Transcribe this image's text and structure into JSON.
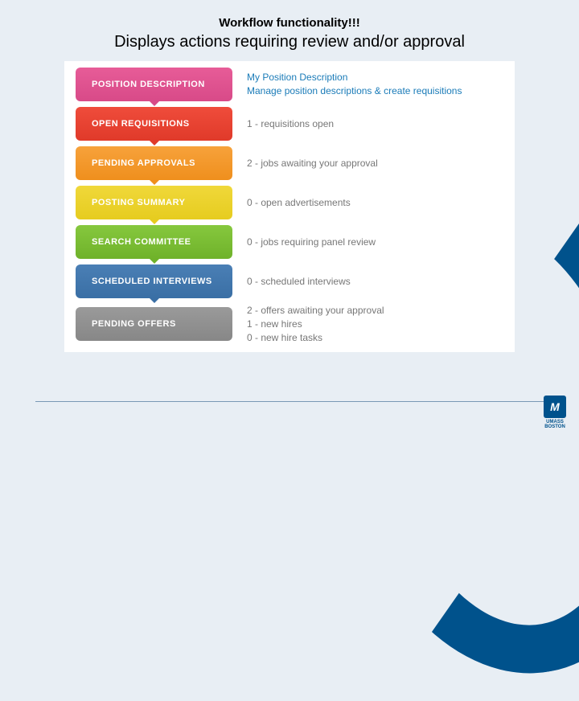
{
  "header": {
    "title": "Workflow functionality!!!",
    "subtitle": "Displays actions requiring review and/or approval"
  },
  "items": [
    {
      "label": "POSITION DESCRIPTION",
      "color": "pink",
      "desc_lines": [
        "My Position Description",
        "Manage position descriptions & create requisitions"
      ],
      "highlight": true
    },
    {
      "label": "OPEN REQUISITIONS",
      "color": "red",
      "desc_lines": [
        "1 - requisitions open"
      ],
      "highlight": false
    },
    {
      "label": "PENDING APPROVALS",
      "color": "orange",
      "desc_lines": [
        "2 - jobs awaiting your approval"
      ],
      "highlight": false
    },
    {
      "label": "POSTING SUMMARY",
      "color": "yellow",
      "desc_lines": [
        "0 - open advertisements"
      ],
      "highlight": false
    },
    {
      "label": "SEARCH COMMITTEE",
      "color": "green",
      "desc_lines": [
        "0 - jobs requiring panel review"
      ],
      "highlight": false
    },
    {
      "label": "SCHEDULED INTERVIEWS",
      "color": "blue",
      "desc_lines": [
        "0 - scheduled interviews"
      ],
      "highlight": false
    },
    {
      "label": "PENDING OFFERS",
      "color": "gray",
      "desc_lines": [
        "2 - offers awaiting your approval",
        "1 - new hires",
        "0 - new hire tasks"
      ],
      "highlight": false
    }
  ],
  "logo": {
    "mark": "M",
    "line1": "UMASS",
    "line2": "BOSTON"
  }
}
